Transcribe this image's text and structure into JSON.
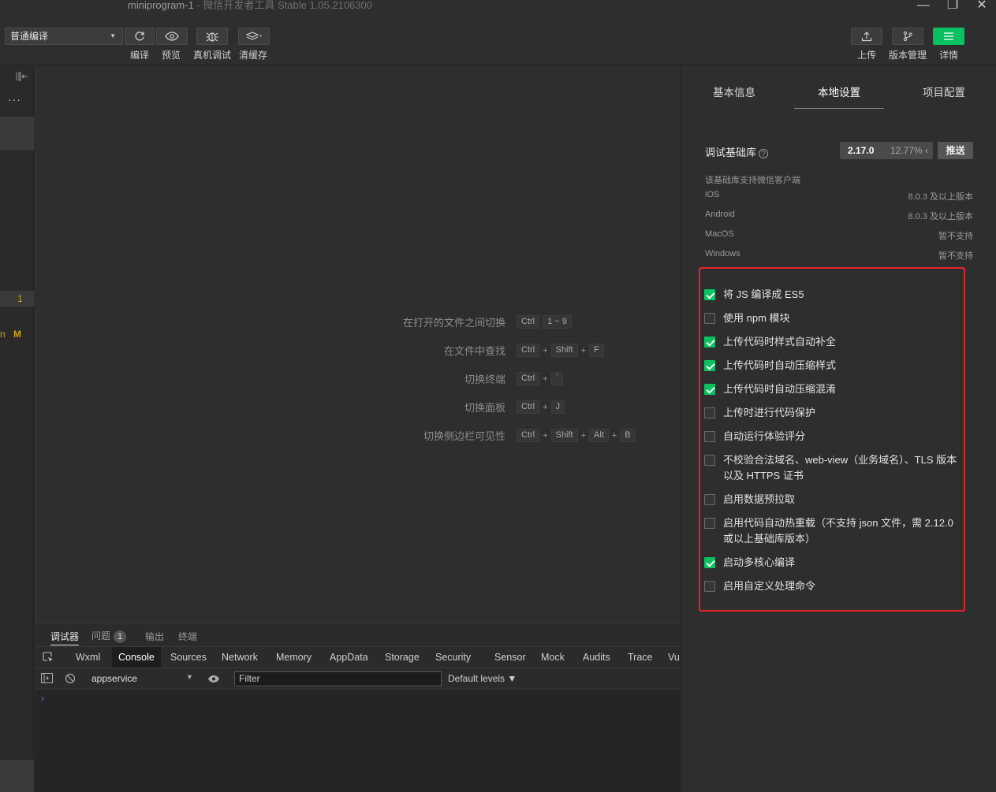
{
  "window": {
    "title": "miniprogram-1",
    "subtitle": " - 微信开发者工具 Stable 1.05.2106300",
    "min": "—",
    "max": "❐",
    "close": "✕"
  },
  "toolbar": {
    "mode": "普通编译",
    "compile": "编译",
    "preview": "预览",
    "remote_debug": "真机调试",
    "clear_cache": "清缓存",
    "upload": "上传",
    "version": "版本管理",
    "details": "详情"
  },
  "left": {
    "more": "···",
    "line_num": "1",
    "n": "n",
    "m": "M"
  },
  "editor_hints": [
    {
      "label": "在打开的文件之间切换",
      "keys": [
        "Ctrl",
        "1 ~ 9"
      ]
    },
    {
      "label": "在文件中查找",
      "keys": [
        "Ctrl",
        "Shift",
        "F"
      ]
    },
    {
      "label": "切换终端",
      "keys": [
        "Ctrl",
        "`"
      ]
    },
    {
      "label": "切换面板",
      "keys": [
        "Ctrl",
        "J"
      ]
    },
    {
      "label": "切换侧边栏可见性",
      "keys": [
        "Ctrl",
        "Shift",
        "Alt",
        "B"
      ]
    }
  ],
  "bottom": {
    "tabs": {
      "debugger": "调试器",
      "issues": "问题",
      "issues_count": "1",
      "output": "输出",
      "terminal": "终端"
    },
    "devtools_tabs": [
      "Wxml",
      "Console",
      "Sources",
      "Network",
      "Memory",
      "AppData",
      "Storage",
      "Security",
      "Sensor",
      "Mock",
      "Audits",
      "Trace",
      "Vu"
    ],
    "context": "appservice",
    "filter_placeholder": "Filter",
    "levels": "Default levels ▼",
    "prompt": "›"
  },
  "right": {
    "tabs": [
      "基本信息",
      "本地设置",
      "项目配置"
    ],
    "active_tab": "本地设置",
    "lib_label": "调试基础库",
    "lib_version": "2.17.0",
    "lib_percent": "12.77% ‹",
    "push": "推送",
    "support_title": "该基础库支持微信客户端",
    "support": [
      {
        "os": "iOS",
        "ver": "8.0.3 及以上版本"
      },
      {
        "os": "Android",
        "ver": "8.0.3 及以上版本"
      },
      {
        "os": "MacOS",
        "ver": "暂不支持"
      },
      {
        "os": "Windows",
        "ver": "暂不支持"
      }
    ],
    "options": [
      {
        "label": "将 JS 编译成 ES5",
        "checked": true
      },
      {
        "label": "使用 npm 模块",
        "checked": false
      },
      {
        "label": "上传代码时样式自动补全",
        "checked": true
      },
      {
        "label": "上传代码时自动压缩样式",
        "checked": true
      },
      {
        "label": "上传代码时自动压缩混淆",
        "checked": true
      },
      {
        "label": "上传时进行代码保护",
        "checked": false
      },
      {
        "label": "自动运行体验评分",
        "checked": false
      },
      {
        "label": "不校验合法域名、web-view（业务域名）、TLS 版本以及 HTTPS 证书",
        "checked": false
      },
      {
        "label": "启用数据预拉取",
        "checked": false
      },
      {
        "label": "启用代码自动热重载（不支持 json 文件，需 2.12.0 或以上基础库版本）",
        "checked": false
      },
      {
        "label": "启动多核心编译",
        "checked": true
      },
      {
        "label": "启用自定义处理命令",
        "checked": false
      }
    ]
  },
  "colors": {
    "accent": "#07c160",
    "highlight_border": "#e8232b",
    "background": "#2e2e2e"
  }
}
